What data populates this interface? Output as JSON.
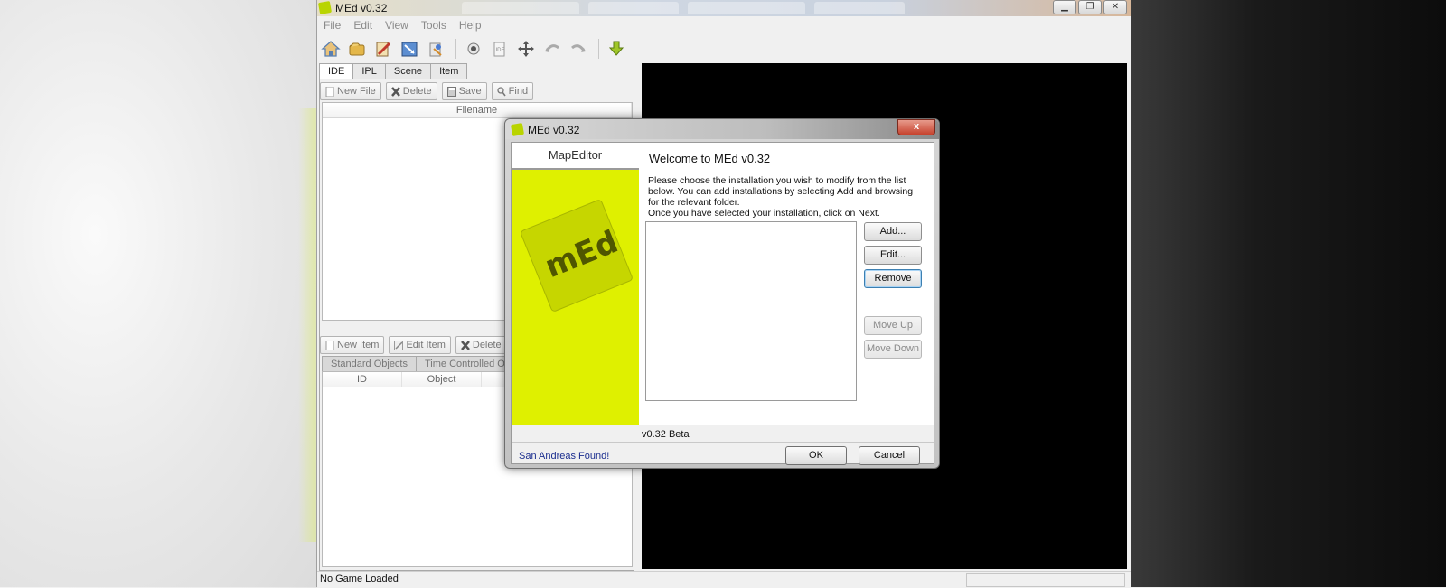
{
  "window": {
    "title": "MEd v0.32",
    "controls": [
      "minimize",
      "maximize",
      "close"
    ]
  },
  "menu": [
    "File",
    "Edit",
    "View",
    "Tools",
    "Help"
  ],
  "toolbar": {
    "icons": [
      "home-icon",
      "open-icon",
      "edit-icon",
      "map-icon",
      "settings-icon",
      "record-icon",
      "ide-icon",
      "move-icon",
      "undo-icon",
      "redo-icon",
      "download-arrow-icon"
    ],
    "ide_label": "IDE"
  },
  "left_panel": {
    "tabs": [
      "IDE",
      "IPL",
      "Scene",
      "Item"
    ],
    "active_tab": "IDE",
    "file_buttons": [
      "New File",
      "Delete",
      "Save",
      "Find"
    ],
    "filelist_header": "Filename",
    "item_buttons": [
      "New Item",
      "Edit Item",
      "Delete Item"
    ],
    "subtabs": [
      "Standard Objects",
      "Time Controlled Objects"
    ],
    "object_columns": [
      "ID",
      "Object"
    ]
  },
  "status": {
    "text": "No Game Loaded"
  },
  "dialog": {
    "title": "MEd v0.32",
    "close_label": "x",
    "side_header": "MapEditor",
    "logo_text": "mEd",
    "welcome": "Welcome to MEd v0.32",
    "desc_line1": "Please choose the installation you wish to modify from the list below. You can add installations by selecting Add and browsing for the relevant folder.",
    "desc_line2": "Once you have selected your installation, click on Next.",
    "buttons": {
      "add": "Add...",
      "edit": "Edit...",
      "remove": "Remove",
      "move_up": "Move Up",
      "move_down": "Move Down"
    },
    "version": "v0.32 Beta",
    "found": "San Andreas Found!",
    "ok": "OK",
    "cancel": "Cancel"
  },
  "colors": {
    "sidebar_yellow": "#dff000",
    "found_text": "#1b2e8f"
  }
}
